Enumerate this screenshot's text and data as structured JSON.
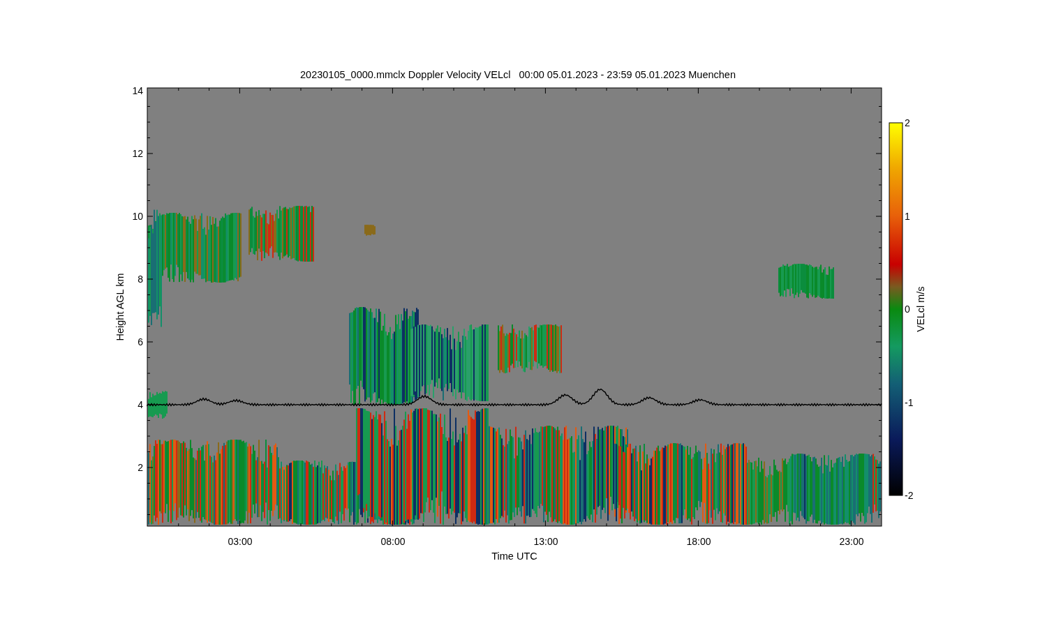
{
  "title": "20230105_0000.mmclx Doppler Velocity VELcl   00:00 05.01.2023 - 23:59 05.01.2023 Muenchen",
  "y_axis": {
    "label": "Height AGL km",
    "ticks": [
      "14",
      "12",
      "10",
      "8",
      "6",
      "4",
      "2"
    ]
  },
  "x_axis": {
    "label": "Time UTC",
    "ticks": [
      "03:00",
      "08:00",
      "13:00",
      "18:00",
      "23:00"
    ]
  },
  "colorbar": {
    "label": "VELcl m/s",
    "ticks": [
      "2",
      "1",
      "0",
      "-1",
      "-2"
    ]
  }
}
